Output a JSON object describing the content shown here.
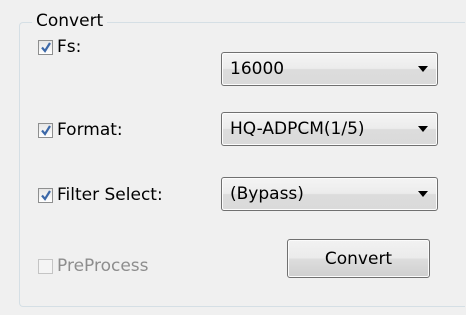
{
  "group": {
    "title": "Convert"
  },
  "fs": {
    "label": "Fs:",
    "checked": true,
    "value": "16000"
  },
  "format": {
    "label": "Format:",
    "checked": true,
    "value": "HQ-ADPCM(1/5)"
  },
  "filter": {
    "label": "Filter Select:",
    "checked": true,
    "value": "(Bypass)"
  },
  "preprocess": {
    "label": "PreProcess",
    "checked": false,
    "enabled": false
  },
  "convert_button": {
    "label": "Convert"
  },
  "colors": {
    "checkmark": "#3c68a8",
    "disabled_text": "#8d8d8d",
    "window_bg": "#f0f0f0"
  }
}
